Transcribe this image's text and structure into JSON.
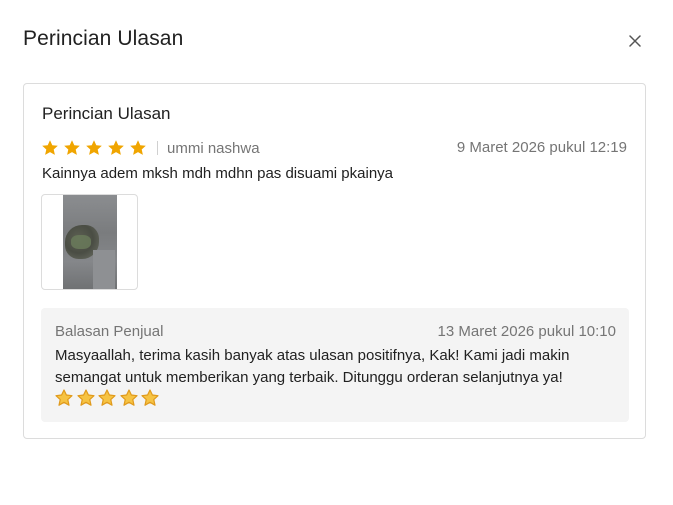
{
  "modal": {
    "title": "Perincian Ulasan",
    "close_icon": "close-icon"
  },
  "review": {
    "title": "Perincian Ulasan",
    "rating": 5,
    "max_rating": 5,
    "star_color": "#f0a500",
    "reviewer": "ummi nashwa",
    "date": "9 Maret 2026 pukul 12:19",
    "text": "Kainnya adem mksh mdh mdhn pas disuami pkainya",
    "photos": [
      "review-photo"
    ]
  },
  "reply": {
    "label": "Balasan Penjual",
    "date": "13 Maret 2026 pukul 10:10",
    "text": "Masyaallah, terima kasih banyak atas ulasan positifnya, Kak! Kami jadi makin semangat untuk memberikan yang terbaik. Ditunggu orderan selanjutnya ya!",
    "emoji_star_count": 5,
    "emoji_icon": "glowing-star-emoji"
  }
}
